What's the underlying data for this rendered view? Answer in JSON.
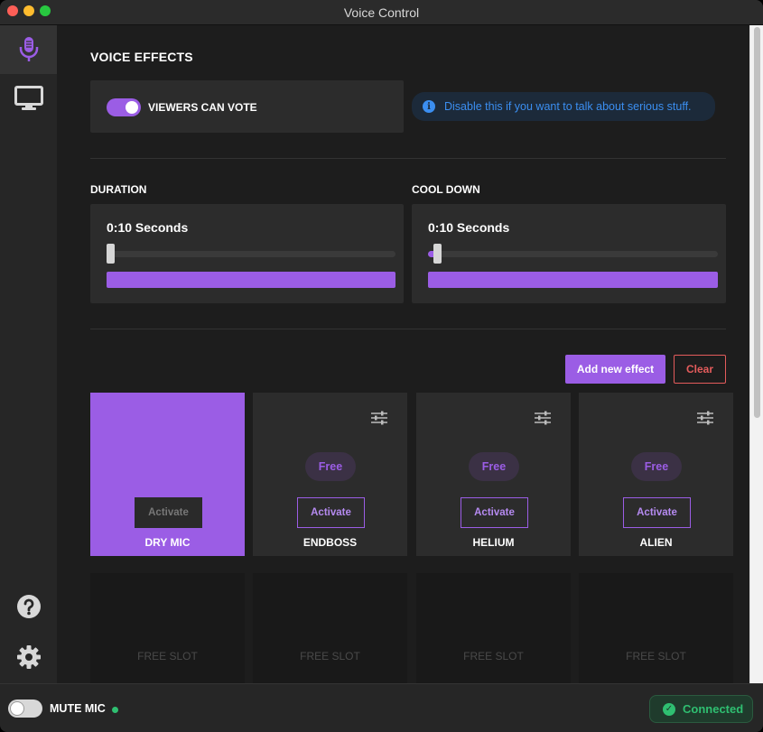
{
  "window": {
    "title": "Voice Control"
  },
  "sidebar": {
    "items": [
      {
        "icon": "microphone-icon",
        "active": true
      },
      {
        "icon": "monitor-icon",
        "active": false
      }
    ],
    "bottom_items": [
      {
        "icon": "help-icon"
      },
      {
        "icon": "gear-icon"
      }
    ]
  },
  "voice_effects": {
    "title": "VOICE EFFECTS",
    "viewers_can_vote": {
      "label": "VIEWERS CAN VOTE",
      "on": true
    },
    "info": "Disable this if you want to talk about serious stuff."
  },
  "duration": {
    "label": "DURATION",
    "value": "0:10 Seconds",
    "slider_fraction": 0
  },
  "cooldown": {
    "label": "COOL DOWN",
    "value": "0:10 Seconds",
    "slider_fraction": 0.02
  },
  "actions": {
    "add_label": "Add new effect",
    "clear_label": "Clear"
  },
  "effects": [
    {
      "name": "DRY MIC",
      "activate_label": "Activate",
      "active": true
    },
    {
      "name": "ENDBOSS",
      "free_label": "Free",
      "activate_label": "Activate",
      "active": false
    },
    {
      "name": "HELIUM",
      "free_label": "Free",
      "activate_label": "Activate",
      "active": false
    },
    {
      "name": "ALIEN",
      "free_label": "Free",
      "activate_label": "Activate",
      "active": false
    }
  ],
  "free_slots": [
    "FREE SLOT",
    "FREE SLOT",
    "FREE SLOT",
    "FREE SLOT"
  ],
  "bottom": {
    "mute_label": "MUTE MIC",
    "mute_on": false,
    "status": "Connected"
  },
  "colors": {
    "accent": "#9b5de5",
    "info": "#3b8ef0",
    "success": "#2fbf71",
    "danger": "#e45c5c"
  }
}
